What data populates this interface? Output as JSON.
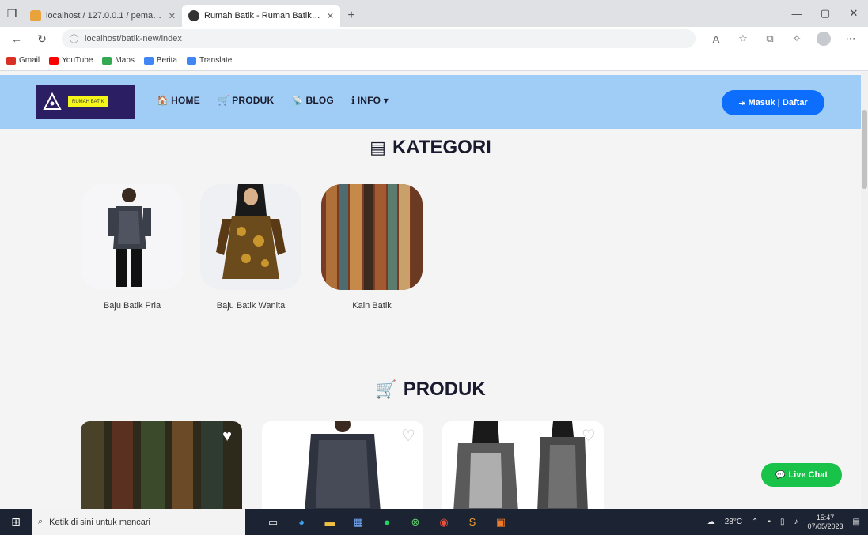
{
  "browser": {
    "tabs": [
      {
        "title": "localhost / 127.0.0.1 / pemasaran",
        "favicon_color": "#e8a33d",
        "active": false
      },
      {
        "title": "Rumah Batik - Rumah Batik Kami",
        "favicon_color": "#333333",
        "active": true
      }
    ],
    "new_tab": "+",
    "window_controls": {
      "minimize": "—",
      "maximize": "▢",
      "close": "✕"
    },
    "address": "localhost/batik-new/index",
    "bookmarks": [
      {
        "label": "Gmail",
        "color": "#d93025"
      },
      {
        "label": "YouTube",
        "color": "#ff0000"
      },
      {
        "label": "Maps",
        "color": "#34a853"
      },
      {
        "label": "Berita",
        "color": "#4285f4"
      },
      {
        "label": "Translate",
        "color": "#4285f4"
      }
    ]
  },
  "site": {
    "logo_text": "RUMAH BATIK",
    "menu": [
      {
        "icon": "🏠",
        "label": "HOME"
      },
      {
        "icon": "🛒",
        "label": "PRODUK"
      },
      {
        "icon": "📡",
        "label": "BLOG"
      },
      {
        "icon": "ℹ",
        "label": "INFO ▾"
      }
    ],
    "login_label": "Masuk | Daftar",
    "login_icon": "⇥",
    "categories_title": "KATEGORI",
    "categories": [
      {
        "label": "Baju Batik Pria"
      },
      {
        "label": "Baju Batik Wanita"
      },
      {
        "label": "Kain Batik"
      }
    ],
    "products_title": "PRODUK",
    "live_chat_label": "Live Chat",
    "live_chat_icon": "💬"
  },
  "taskbar": {
    "search_placeholder": "Ketik di sini untuk mencari",
    "weather": "28°C",
    "time": "15:47",
    "date": "07/05/2023"
  },
  "colors": {
    "header_bg": "#9fcdf5",
    "logo_bg": "#2c1e63",
    "logo_label_bg": "#f5f51a",
    "login_button": "#0d6efd",
    "live_chat": "#19c34a"
  }
}
